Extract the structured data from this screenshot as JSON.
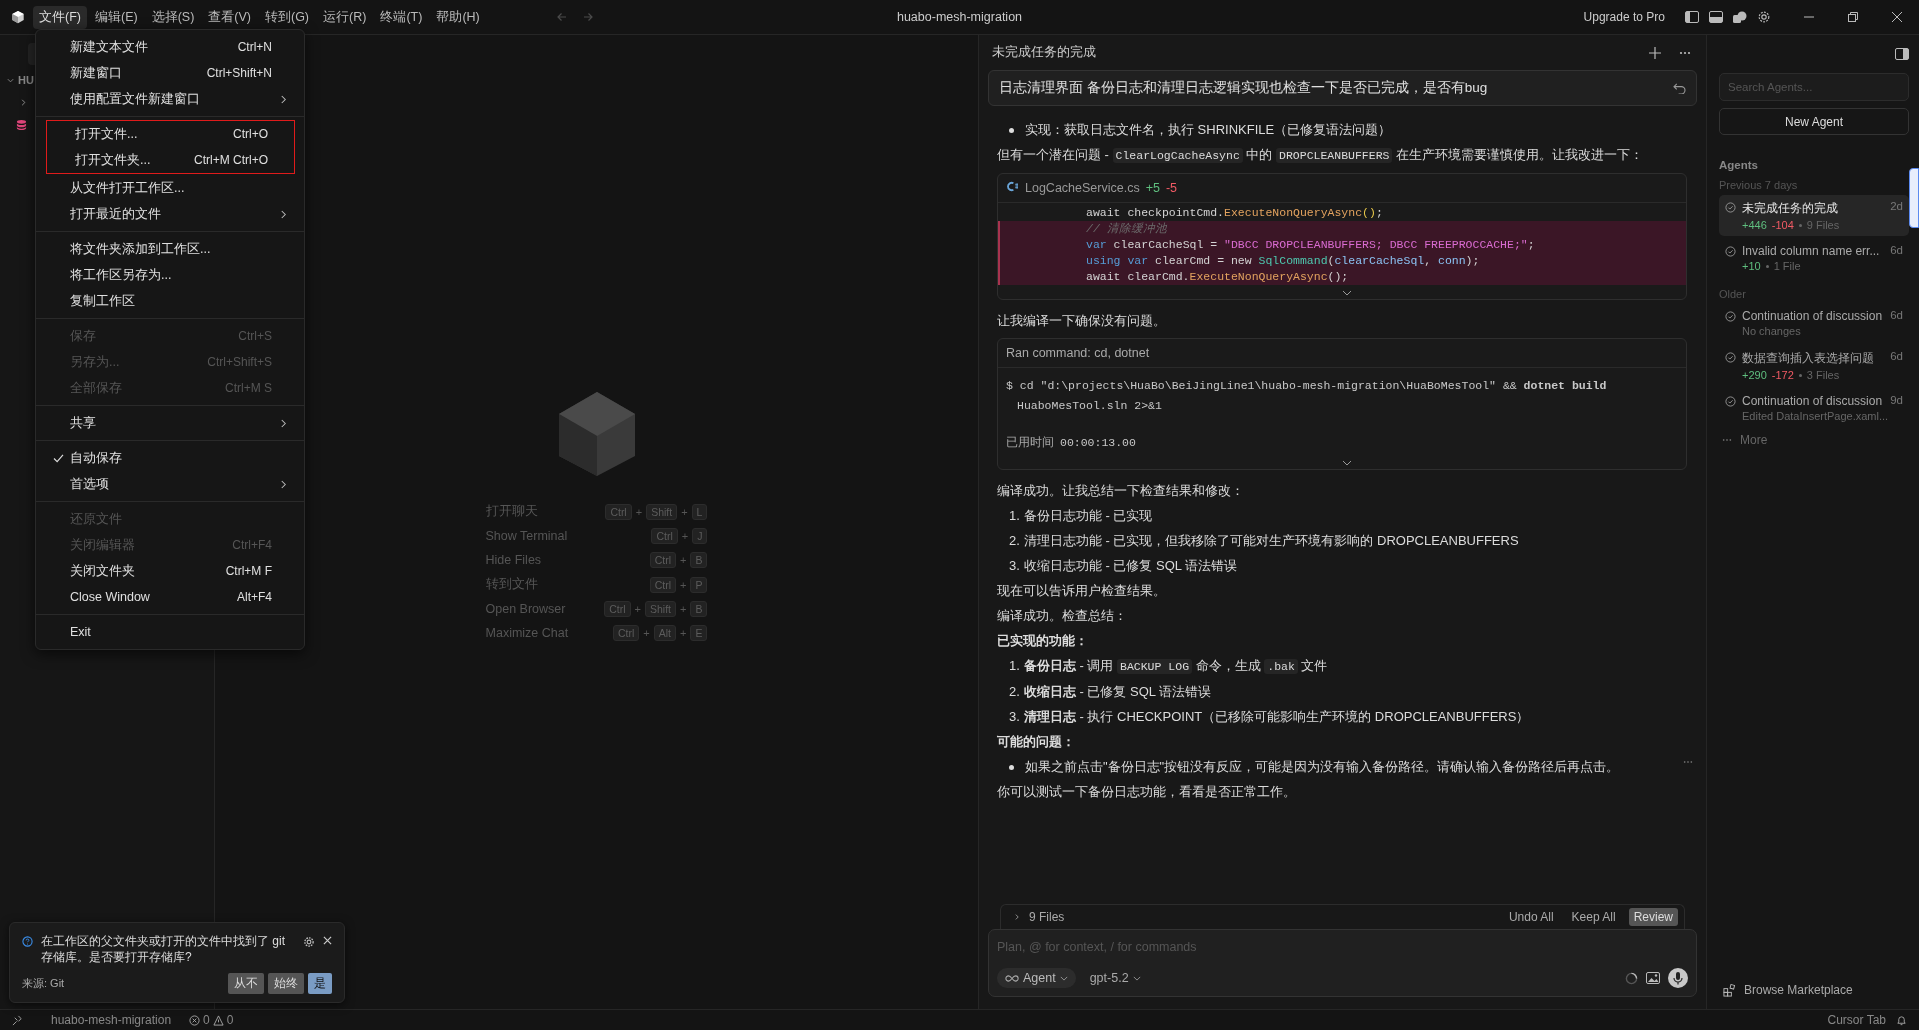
{
  "titlebar": {
    "menus": [
      {
        "label": "文件(F)",
        "selected": true
      },
      {
        "label": "编辑(E)",
        "selected": false
      },
      {
        "label": "选择(S)",
        "selected": false
      },
      {
        "label": "查看(V)",
        "selected": false
      },
      {
        "label": "转到(G)",
        "selected": false
      },
      {
        "label": "运行(R)",
        "selected": false
      },
      {
        "label": "终端(T)",
        "selected": false
      },
      {
        "label": "帮助(H)",
        "selected": false
      }
    ],
    "title": "huabo-mesh-migration",
    "upgrade": "Upgrade to Pro"
  },
  "explorer": {
    "header": "HU"
  },
  "file_menu": {
    "sections": [
      {
        "items": [
          {
            "label": "新建文本文件",
            "shortcut": "Ctrl+N",
            "submenu": false,
            "disabled": false,
            "checked": false,
            "outlined": false
          },
          {
            "label": "新建窗口",
            "shortcut": "Ctrl+Shift+N",
            "submenu": false,
            "disabled": false,
            "checked": false,
            "outlined": false
          },
          {
            "label": "使用配置文件新建窗口",
            "submenu": true,
            "disabled": false,
            "checked": false,
            "outlined": false
          }
        ]
      },
      {
        "items": [
          {
            "label": "打开文件...",
            "shortcut": "Ctrl+O",
            "submenu": false,
            "disabled": false,
            "checked": false,
            "outlined": true
          },
          {
            "label": "打开文件夹...",
            "shortcut": "Ctrl+M Ctrl+O",
            "submenu": false,
            "disabled": false,
            "checked": false,
            "outlined": true
          },
          {
            "label": "从文件打开工作区...",
            "submenu": false,
            "disabled": false,
            "checked": false,
            "outlined": false
          },
          {
            "label": "打开最近的文件",
            "submenu": true,
            "disabled": false,
            "checked": false,
            "outlined": false
          }
        ]
      },
      {
        "items": [
          {
            "label": "将文件夹添加到工作区...",
            "submenu": false,
            "disabled": false,
            "checked": false,
            "outlined": false
          },
          {
            "label": "将工作区另存为...",
            "submenu": false,
            "disabled": false,
            "checked": false,
            "outlined": false
          },
          {
            "label": "复制工作区",
            "submenu": false,
            "disabled": false,
            "checked": false,
            "outlined": false
          }
        ]
      },
      {
        "items": [
          {
            "label": "保存",
            "shortcut": "Ctrl+S",
            "submenu": false,
            "disabled": true,
            "checked": false,
            "outlined": false
          },
          {
            "label": "另存为...",
            "shortcut": "Ctrl+Shift+S",
            "submenu": false,
            "disabled": true,
            "checked": false,
            "outlined": false
          },
          {
            "label": "全部保存",
            "shortcut": "Ctrl+M S",
            "submenu": false,
            "disabled": true,
            "checked": false,
            "outlined": false
          }
        ]
      },
      {
        "items": [
          {
            "label": "共享",
            "submenu": true,
            "disabled": false,
            "checked": false,
            "outlined": false
          }
        ]
      },
      {
        "items": [
          {
            "label": "自动保存",
            "submenu": false,
            "disabled": false,
            "checked": true,
            "outlined": false
          },
          {
            "label": "首选项",
            "submenu": true,
            "disabled": false,
            "checked": false,
            "outlined": false
          }
        ]
      },
      {
        "items": [
          {
            "label": "还原文件",
            "submenu": false,
            "disabled": true,
            "checked": false,
            "outlined": false
          },
          {
            "label": "关闭编辑器",
            "shortcut": "Ctrl+F4",
            "submenu": false,
            "disabled": true,
            "checked": false,
            "outlined": false
          },
          {
            "label": "关闭文件夹",
            "shortcut": "Ctrl+M F",
            "submenu": false,
            "disabled": false,
            "checked": false,
            "outlined": false
          },
          {
            "label": "Close Window",
            "shortcut": "Alt+F4",
            "submenu": false,
            "disabled": false,
            "checked": false,
            "outlined": false
          }
        ]
      },
      {
        "items": [
          {
            "label": "Exit",
            "submenu": false,
            "disabled": false,
            "checked": false,
            "outlined": false
          }
        ]
      }
    ]
  },
  "editor": {
    "key_joiner": "+",
    "shortcuts": [
      {
        "label": "打开聊天",
        "keys": [
          "Ctrl",
          "Shift",
          "L"
        ]
      },
      {
        "label": "Show Terminal",
        "keys": [
          "Ctrl",
          "J"
        ]
      },
      {
        "label": "Hide Files",
        "keys": [
          "Ctrl",
          "B"
        ]
      },
      {
        "label": "转到文件",
        "keys": [
          "Ctrl",
          "P"
        ]
      },
      {
        "label": "Open Browser",
        "keys": [
          "Ctrl",
          "Shift",
          "B"
        ]
      },
      {
        "label": "Maximize Chat",
        "keys": [
          "Ctrl",
          "Alt",
          "E"
        ]
      }
    ]
  },
  "chat": {
    "title": "未完成任务的完成",
    "prompt": "日志清理界面 备份日志和清理日志逻辑实现也检查一下是否已完成，是否有bug",
    "blocks": [
      {
        "kind": "bullets",
        "items": [
          [
            {
              "text": "实现：获取日志文件名，执行 SHRINKFILE（已修复语法问题）",
              "kind": "plain"
            }
          ]
        ]
      },
      {
        "kind": "para",
        "segments": [
          {
            "text": "但有一个潜在问题 - ",
            "kind": "plain"
          },
          {
            "text": "ClearLogCacheAsync",
            "kind": "code"
          },
          {
            "text": " 中的 ",
            "kind": "plain"
          },
          {
            "text": "DROPCLEANBUFFERS",
            "kind": "code"
          },
          {
            "text": " 在生产环境需要谨慎使用。让我改进一下：",
            "kind": "plain"
          }
        ]
      },
      {
        "kind": "diff",
        "file": "LogCacheService.cs",
        "added": "+5",
        "removed": "-5",
        "lines": [
          {
            "removed": false,
            "tokens": [
              {
                "t": "await checkpointCmd.",
                "kind": "plain"
              },
              {
                "t": "ExecuteNonQueryAsync",
                "kind": "fn"
              },
              {
                "t": "()",
                "kind": "punc"
              },
              {
                "t": ";",
                "kind": "plain"
              }
            ]
          },
          {
            "removed": true,
            "tokens": [
              {
                "t": "// 清除缓冲池",
                "kind": "comment"
              }
            ]
          },
          {
            "removed": true,
            "tokens": [
              {
                "t": "var",
                "kind": "kw"
              },
              {
                "t": " clearCacheSql = ",
                "kind": "plain"
              },
              {
                "t": "\"DBCC DROPCLEANBUFFERS; DBCC FREEPROCCACHE;\"",
                "kind": "str"
              },
              {
                "t": ";",
                "kind": "plain"
              }
            ]
          },
          {
            "removed": true,
            "tokens": [
              {
                "t": "using var",
                "kind": "kw"
              },
              {
                "t": " clearCmd = new ",
                "kind": "plain"
              },
              {
                "t": "SqlCommand",
                "kind": "type"
              },
              {
                "t": "(",
                "kind": "plain"
              },
              {
                "t": "clearCacheSql",
                "kind": "var"
              },
              {
                "t": ", ",
                "kind": "plain"
              },
              {
                "t": "conn",
                "kind": "var"
              },
              {
                "t": ");",
                "kind": "plain"
              }
            ]
          },
          {
            "removed": true,
            "tokens": [
              {
                "t": "await clearCmd.",
                "kind": "plain"
              },
              {
                "t": "ExecuteNonQueryAsync",
                "kind": "fn"
              },
              {
                "t": "();",
                "kind": "plain"
              }
            ]
          }
        ]
      },
      {
        "kind": "para",
        "segments": [
          {
            "text": "让我编译一下确保没有问题。",
            "kind": "plain"
          }
        ]
      },
      {
        "kind": "command",
        "title": "Ran command: cd, dotnet",
        "command": [
          {
            "t": "$ cd \"d:\\projects\\HuaBo\\BeiJingLine1\\huabo-mesh-migration\\HuaBoMesTool\" && ",
            "kind": "plain"
          },
          {
            "t": "dotnet build",
            "kind": "bold"
          },
          {
            "t": " HuaboMesTool.sln 2>&1",
            "kind": "plain"
          }
        ],
        "elapsed_label": "已用时间",
        "elapsed": "00:00:13.00"
      },
      {
        "kind": "para",
        "segments": [
          {
            "text": "编译成功。让我总结一下检查结果和修改：",
            "kind": "plain"
          }
        ]
      },
      {
        "kind": "numbered",
        "items": [
          {
            "number": "1.",
            "segments": [
              {
                "text": "备份日志功能 - 已实现",
                "kind": "plain"
              }
            ]
          },
          {
            "number": "2.",
            "segments": [
              {
                "text": "清理日志功能 - 已实现，但我移除了可能对生产环境有影响的 DROPCLEANBUFFERS",
                "kind": "plain"
              }
            ]
          },
          {
            "number": "3.",
            "segments": [
              {
                "text": "收缩日志功能 - 已修复 SQL 语法错误",
                "kind": "plain"
              }
            ]
          }
        ]
      },
      {
        "kind": "para",
        "segments": [
          {
            "text": "现在可以告诉用户检查结果。",
            "kind": "plain"
          }
        ]
      },
      {
        "kind": "para",
        "segments": [
          {
            "text": "编译成功。检查总结：",
            "kind": "plain"
          }
        ]
      },
      {
        "kind": "para",
        "segments": [
          {
            "text": "已实现的功能：",
            "kind": "bold"
          }
        ]
      },
      {
        "kind": "numbered",
        "items": [
          {
            "number": "1.",
            "segments": [
              {
                "text": "备份日志",
                "kind": "bold"
              },
              {
                "text": " - 调用 ",
                "kind": "plain"
              },
              {
                "text": "BACKUP LOG",
                "kind": "code"
              },
              {
                "text": " 命令，生成 ",
                "kind": "plain"
              },
              {
                "text": ".bak",
                "kind": "code"
              },
              {
                "text": " 文件",
                "kind": "plain"
              }
            ]
          },
          {
            "number": "2.",
            "segments": [
              {
                "text": "收缩日志",
                "kind": "bold"
              },
              {
                "text": " - 已修复 SQL 语法错误",
                "kind": "plain"
              }
            ]
          },
          {
            "number": "3.",
            "segments": [
              {
                "text": "清理日志",
                "kind": "bold"
              },
              {
                "text": " - 执行 CHECKPOINT（已移除可能影响生产环境的 DROPCLEANBUFFERS）",
                "kind": "plain"
              }
            ]
          }
        ]
      },
      {
        "kind": "para",
        "segments": [
          {
            "text": "可能的问题：",
            "kind": "bold"
          }
        ]
      },
      {
        "kind": "bullets",
        "items": [
          [
            {
              "text": "如果之前点击\"备份日志\"按钮没有反应，可能是因为没有输入备份路径。请确认输入备份路径后再点击。",
              "kind": "plain"
            }
          ]
        ]
      },
      {
        "kind": "para",
        "segments": [
          {
            "text": "你可以测试一下备份日志功能，看看是否正常工作。",
            "kind": "plain"
          }
        ]
      }
    ],
    "changes": {
      "files": "9 Files",
      "actions": [
        {
          "label": "Undo All",
          "primary": false
        },
        {
          "label": "Keep All",
          "primary": false
        },
        {
          "label": "Review",
          "primary": true
        }
      ]
    },
    "composer": {
      "placeholder": "Plan, @ for context, / for commands",
      "mode": "Agent",
      "model": "gpt-5.2"
    }
  },
  "agents": {
    "search_placeholder": "Search Agents...",
    "new_label": "New Agent",
    "heading": "Agents",
    "groups": [
      {
        "label": "Previous 7 days",
        "items": [
          {
            "title": "未完成任务的完成",
            "age": "2d",
            "added": "+446",
            "removed": "-104",
            "detail": "9 Files",
            "selected": true
          },
          {
            "title": "Invalid column name err...",
            "age": "6d",
            "added": "+10",
            "detail": "1 File",
            "selected": false
          }
        ]
      },
      {
        "label": "Older",
        "items": [
          {
            "title": "Continuation of discussion",
            "age": "6d",
            "detail": "No changes",
            "selected": false
          },
          {
            "title": "数据查询插入表选择问题",
            "age": "6d",
            "added": "+290",
            "removed": "-172",
            "detail": "3 Files",
            "selected": false
          },
          {
            "title": "Continuation of discussion",
            "age": "9d",
            "detail": "Edited DataInsertPage.xaml...",
            "selected": false
          }
        ]
      }
    ],
    "more": "More",
    "marketplace": "Browse Marketplace"
  },
  "toast": {
    "message": "在工作区的父文件夹或打开的文件中找到了 git 存储库。是否要打开存储库?",
    "source": "来源: Git",
    "buttons": [
      {
        "label": "从不",
        "primary": false
      },
      {
        "label": "始终",
        "primary": false
      },
      {
        "label": "是",
        "primary": true
      }
    ]
  },
  "status_bar": {
    "folder": "huabo-mesh-migration",
    "errors": "0",
    "warnings": "0",
    "right": "Cursor Tab"
  }
}
